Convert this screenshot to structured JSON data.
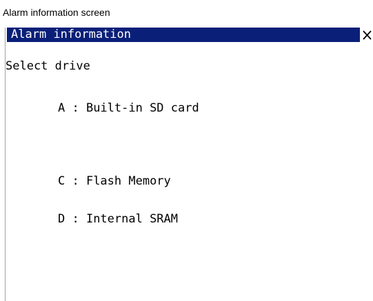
{
  "caption": "Alarm information screen",
  "window": {
    "title": "Alarm information",
    "close_icon": "close-icon"
  },
  "prompt": "Select drive",
  "drives": [
    {
      "letter": "A",
      "separator": ":",
      "label": "Built-in SD card"
    },
    {
      "letter": "C",
      "separator": ":",
      "label": "Flash Memory"
    },
    {
      "letter": "D",
      "separator": ":",
      "label": "Internal SRAM"
    }
  ],
  "colors": {
    "title_bar_bg": "#0a1f78",
    "title_bar_text": "#ffffff",
    "text": "#000000",
    "background": "#ffffff"
  }
}
